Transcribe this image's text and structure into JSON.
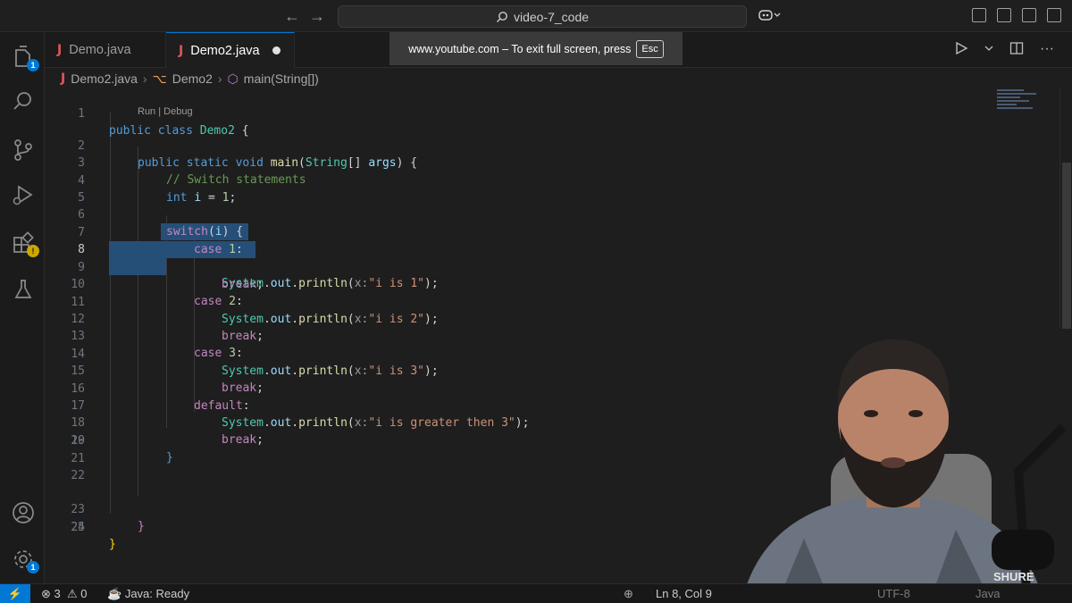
{
  "titlebar": {
    "search_text": "video-7_code",
    "back_arrow": "←",
    "forward_arrow": "→"
  },
  "tabs": [
    {
      "icon": "J",
      "label": "Demo.java"
    },
    {
      "icon": "J",
      "label": "Demo2.java"
    }
  ],
  "fullscreen_toast": {
    "text": "www.youtube.com – To exit full screen, press",
    "key": "Esc"
  },
  "breadcrumb": {
    "file": "Demo2.java",
    "class": "Demo2",
    "method": "main(String[])"
  },
  "codelens": "Run | Debug",
  "line_numbers": [
    "1",
    "2",
    "3",
    "4",
    "5",
    "6",
    "7",
    "8",
    "9",
    "10",
    "11",
    "12",
    "13",
    "14",
    "15",
    "16",
    "17",
    "18",
    "19",
    "20",
    "21",
    "22",
    "23",
    "24",
    "25"
  ],
  "code": {
    "l1_kw1": "public",
    "l1_kw2": "class",
    "l1_cls": "Demo2",
    "l1_rest": " {",
    "l2_kw1": "public",
    "l2_kw2": "static",
    "l2_kw3": "void",
    "l2_fn": "main",
    "l2_p1": "(",
    "l2_cls": "String",
    "l2_p2": "[] ",
    "l2_var": "args",
    "l2_p3": ") {",
    "l3_cmt": "// Switch statements",
    "l4_kw": "int",
    "l4_var": "i",
    "l4_eq": " = ",
    "l4_num": "1",
    "l4_end": ";",
    "l6_kw": "switch",
    "l6_p1": "(",
    "l6_var": "i",
    "l6_p2": ") {",
    "l7_kw": "case",
    "l7_num": "1",
    "l7_end": ":",
    "l8_cls": "System",
    "l8_dot": ".",
    "l8_var": "out",
    "l8_fn": ".println",
    "l8_p": "(",
    "l8_hint": "x:",
    "l8_str": "\"i is 1\"",
    "l8_end": ");",
    "l9_kw": "break",
    "l9_end": ";",
    "l10_kw": "case",
    "l10_num": "2",
    "l10_end": ":",
    "l11_cls": "System",
    "l11_dot": ".",
    "l11_var": "out",
    "l11_fn": ".println",
    "l11_p": "(",
    "l11_hint": "x:",
    "l11_str": "\"i is 2\"",
    "l11_end": ");",
    "l12_kw": "break",
    "l12_end": ";",
    "l13_kw": "case",
    "l13_num": "3",
    "l13_end": ":",
    "l14_cls": "System",
    "l14_dot": ".",
    "l14_var": "out",
    "l14_fn": ".println",
    "l14_p": "(",
    "l14_hint": "x:",
    "l14_str": "\"i is 3\"",
    "l14_end": ");",
    "l15_kw": "break",
    "l15_end": ";",
    "l16_kw": "default",
    "l16_end": ":",
    "l17_cls": "System",
    "l17_dot": ".",
    "l17_var": "out",
    "l17_fn": ".println",
    "l17_p": "(",
    "l17_hint": "x:",
    "l17_str": "\"i is greater then 3\"",
    "l17_end": ");",
    "l18_kw": "break",
    "l18_end": ";",
    "l19": "}",
    "l23": "}",
    "l24": "}"
  },
  "activity_badges": {
    "explorer": "1",
    "settings": "1"
  },
  "statusbar": {
    "errors": "3",
    "warnings": "0",
    "java_status": "Java: Ready",
    "cursor": "Ln 8, Col 9",
    "encoding": "UTF-8",
    "language": "Java"
  },
  "colors": {
    "accent": "#0078d4",
    "keyword": "#569cd6",
    "control_keyword": "#c586c0",
    "class": "#4ec9b0",
    "string": "#ce9178",
    "comment": "#6a9955",
    "selection": "#264f78"
  }
}
